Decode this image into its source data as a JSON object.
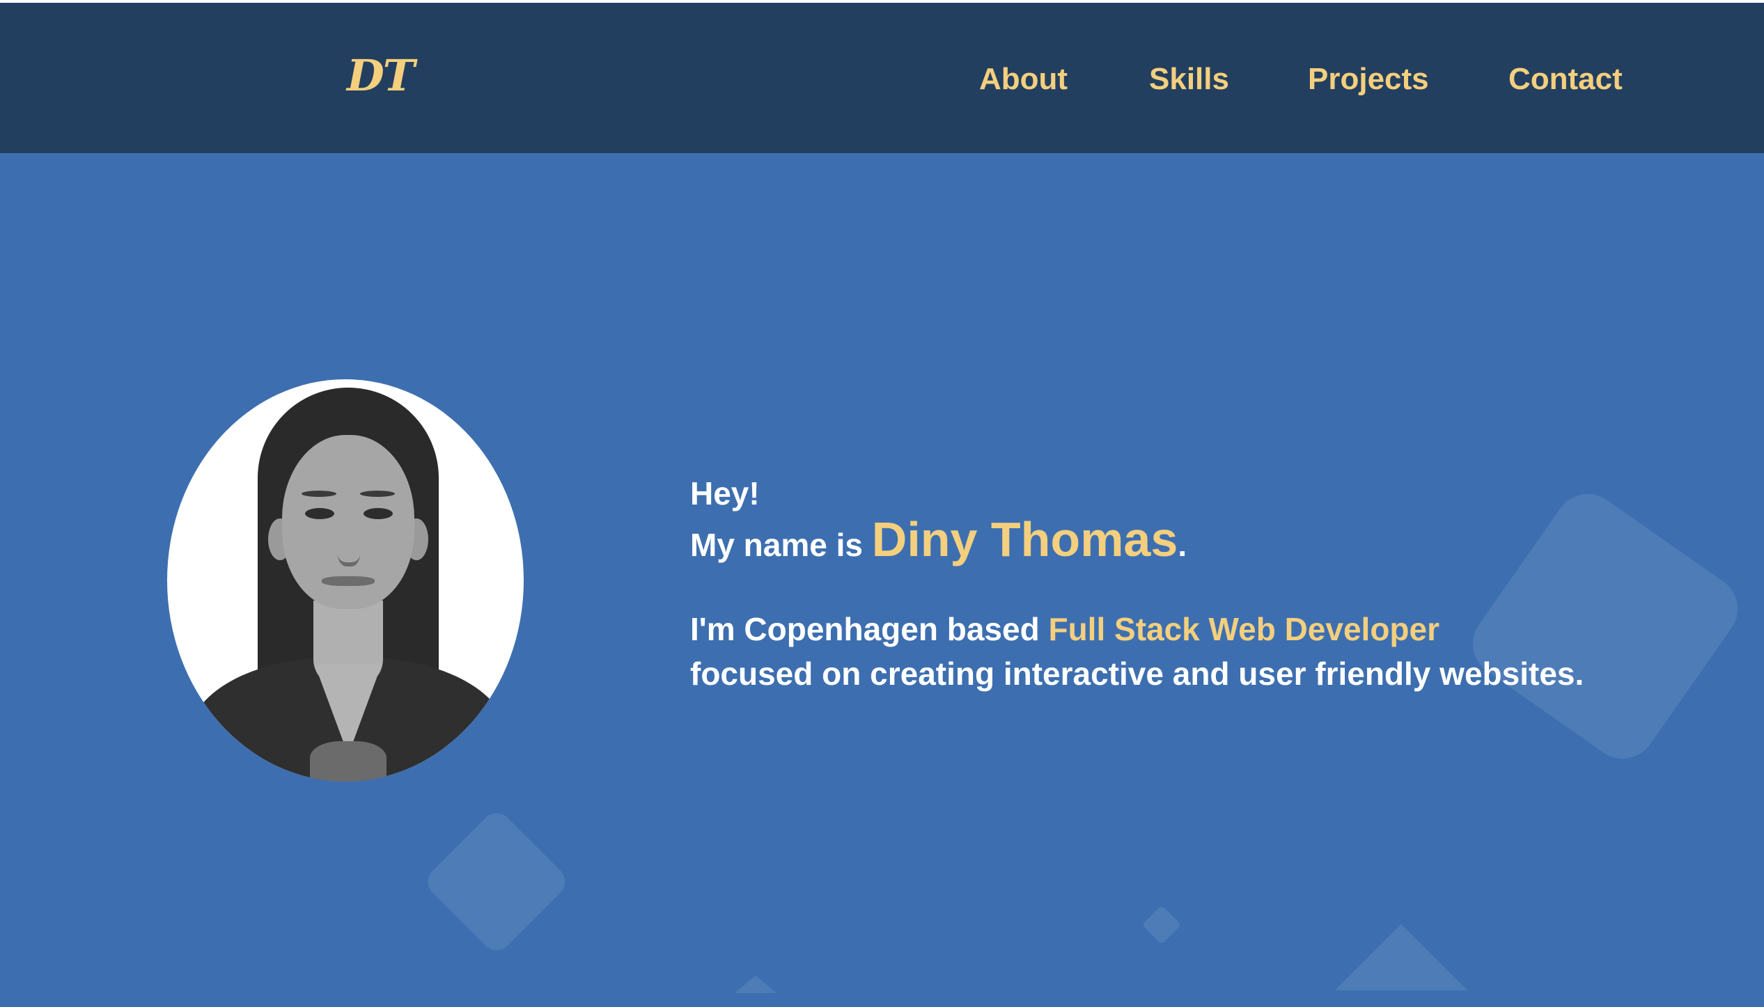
{
  "header": {
    "logo": "DT",
    "nav": [
      {
        "label": "About"
      },
      {
        "label": "Skills"
      },
      {
        "label": "Projects"
      },
      {
        "label": "Contact"
      }
    ]
  },
  "hero": {
    "greeting": "Hey!",
    "name_prefix": "My name is",
    "name": "Diny Thomas",
    "name_suffix": ".",
    "intro_prefix": "I'm Copenhagen based",
    "role": "Full Stack Web Developer",
    "intro_line2": "focused on creating interactive and user friendly websites."
  },
  "colors": {
    "header_bg": "#233f5f",
    "hero_bg": "#3d6fb0",
    "accent": "#f4cf7e",
    "text": "#ffffff"
  },
  "icons": {
    "logo": "dt-monogram",
    "background_shapes": [
      "rounded-diamond",
      "rounded-diamond",
      "small-diamond",
      "triangle",
      "triangle"
    ]
  }
}
